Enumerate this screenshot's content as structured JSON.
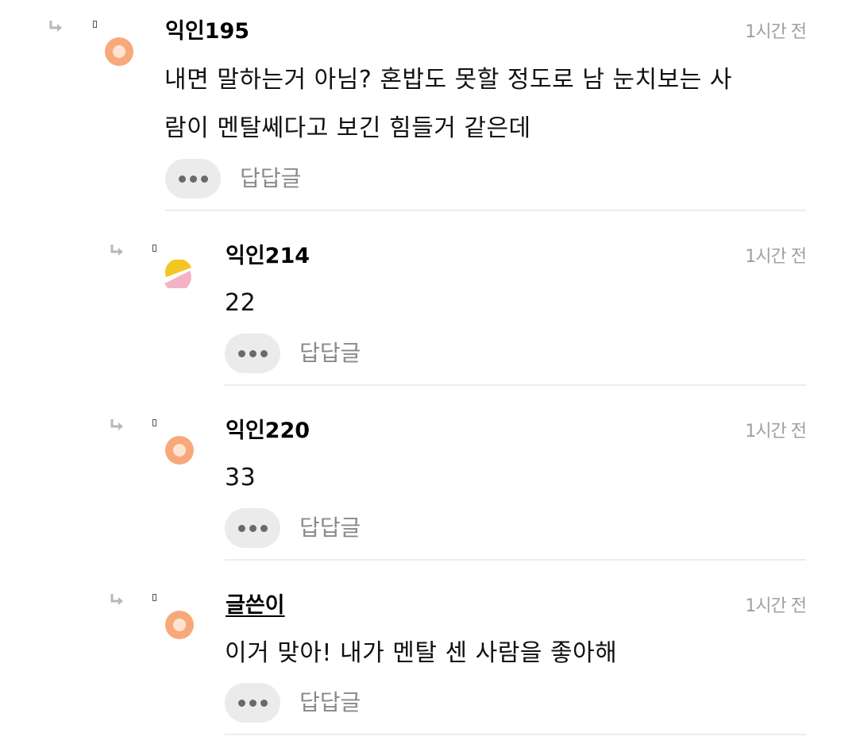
{
  "comments": [
    {
      "nickname": "익인195",
      "time": "1시간 전",
      "text_lines": [
        "내면 말하는거 아님? 혼밥도 못할 정도로 남 눈치보는 사",
        "람이 멘탈쎄다고 보긴 힘들거 같은데"
      ],
      "reply_label": "답답글",
      "avatar": "orange-circle-avatar"
    },
    {
      "nickname": "익인214",
      "time": "1시간 전",
      "text_lines": [
        "22"
      ],
      "reply_label": "답답글",
      "avatar": "yellow-pink-avatar"
    },
    {
      "nickname": "익인220",
      "time": "1시간 전",
      "text_lines": [
        "33"
      ],
      "reply_label": "답답글",
      "avatar": "orange-circle-avatar"
    },
    {
      "nickname": "글쓴이",
      "time": "1시간 전",
      "text_lines": [
        "이거 맞아! 내가 멘탈 센 사람을 좋아해"
      ],
      "reply_label": "답답글",
      "avatar": "orange-circle-avatar",
      "is_author": true
    }
  ],
  "colors": {
    "avatar_orange": "#f7a97a",
    "avatar_orange_inner": "#fde3d2",
    "avatar_yellow": "#f3c623",
    "avatar_pink": "#f4b3c5",
    "time_gray": "#a0a0a0",
    "button_bg": "#ebebeb"
  },
  "icons": {
    "reply_arrow": "reply-arrow-icon",
    "more": "more-dots-icon"
  }
}
